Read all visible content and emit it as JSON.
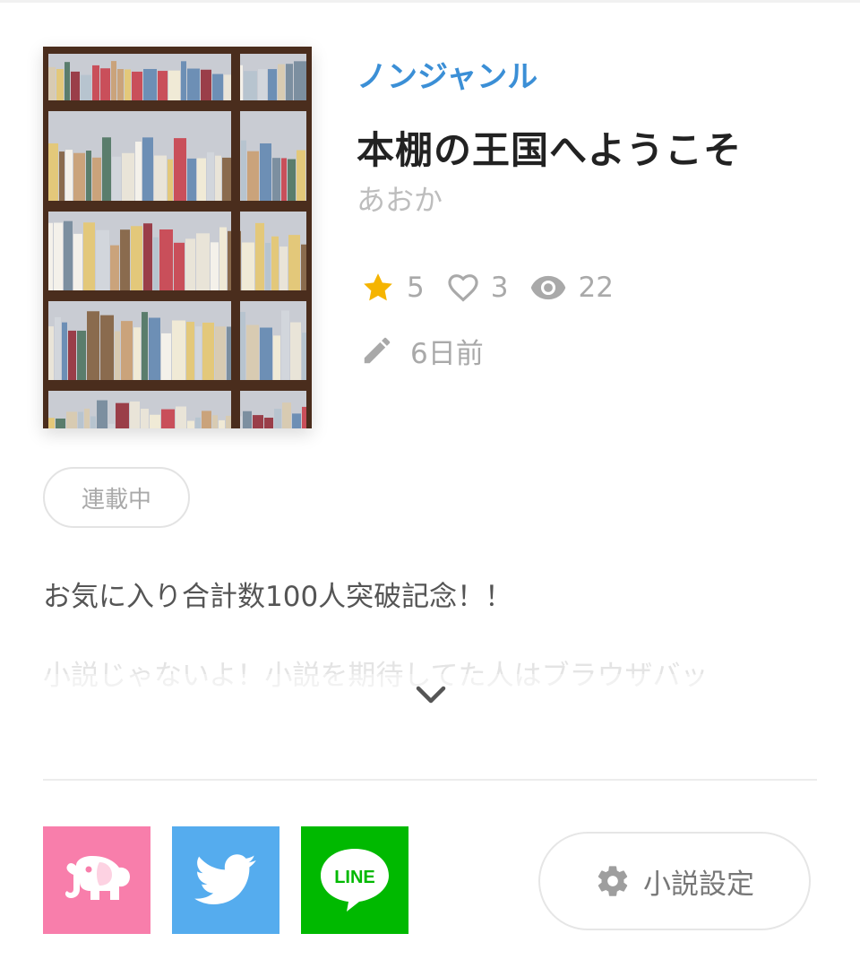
{
  "novel": {
    "genre": "ノンジャンル",
    "title": "本棚の王国へようこそ",
    "author": "あおか",
    "status_badge": "連載中"
  },
  "stats": {
    "stars": "5",
    "likes": "3",
    "views": "22",
    "updated": "6日前"
  },
  "description": {
    "line1": "お気に入り合計数100人突破記念！！",
    "line2": "小説じゃないよ！小説を期待してた人はブラウザバッ"
  },
  "share": {
    "line_label": "LINE"
  },
  "settings_button": {
    "label": "小説設定"
  },
  "icons": {
    "star": "star-icon",
    "heart": "heart-icon",
    "eye": "eye-icon",
    "pencil": "pencil-icon",
    "expand": "chevron-down-icon",
    "elephant": "elephant-icon",
    "twitter": "twitter-bird-icon",
    "gear": "gear-icon"
  },
  "colors": {
    "genre": "#3b8fd6",
    "star": "#f5b400",
    "share_pink": "#f87eab",
    "share_twitter": "#55acee",
    "share_line": "#00b900"
  }
}
